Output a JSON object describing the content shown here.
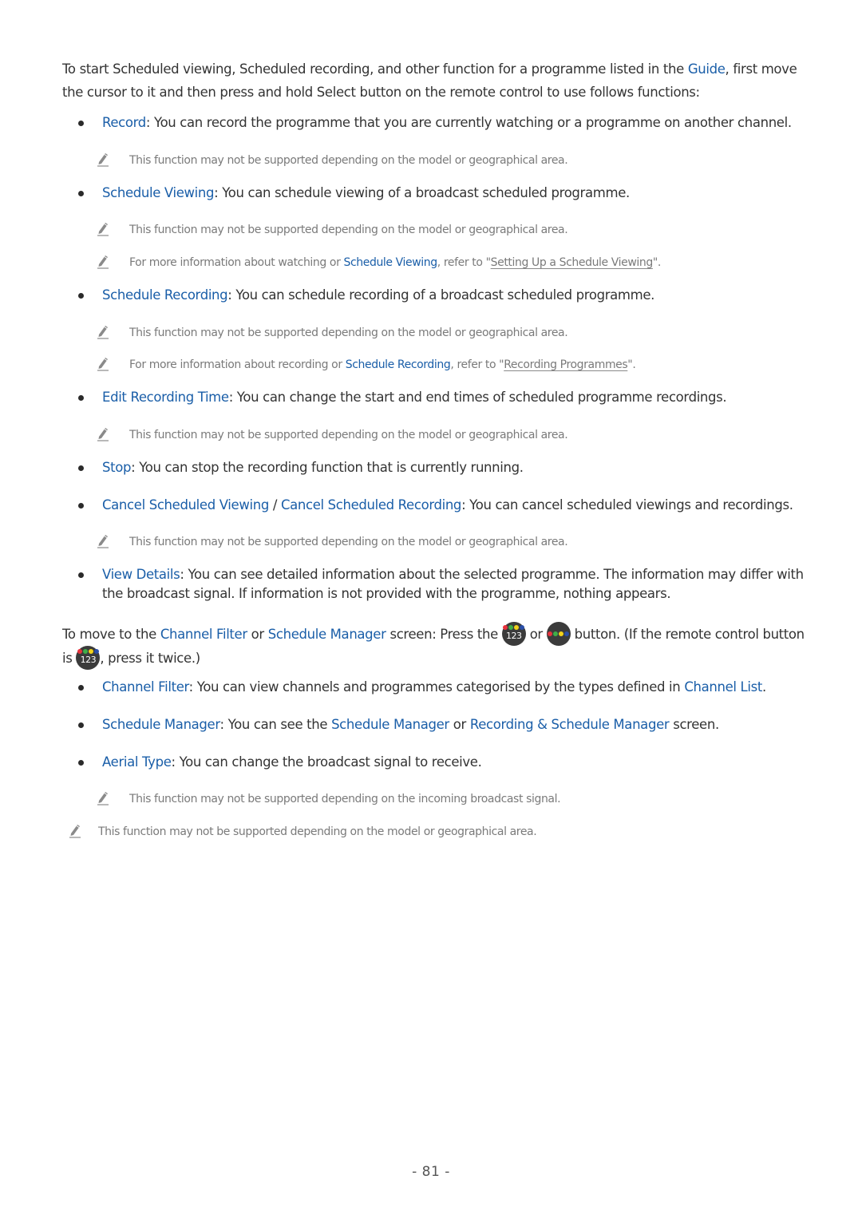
{
  "intro": {
    "text_before": "To start Scheduled viewing, Scheduled recording, and other function for a programme listed in the ",
    "link": "Guide",
    "text_after": ", first move the cursor to it and then press and hold Select button on the remote control to use follows functions:"
  },
  "functions": [
    {
      "term": "Record",
      "desc": ": You can record the programme that you are currently watching or a programme on another channel.",
      "notes": [
        {
          "text": "This function may not be supported depending on the model or geographical area."
        }
      ]
    },
    {
      "term": "Schedule Viewing",
      "desc": ": You can schedule viewing of a broadcast scheduled programme.",
      "notes": [
        {
          "text": "This function may not be supported depending on the model or geographical area."
        },
        {
          "before": "For more information about watching or ",
          "link": "Schedule Viewing",
          "middle": ", refer to \"",
          "xref": "Setting Up a Schedule Viewing",
          "after": "\"."
        }
      ]
    },
    {
      "term": "Schedule Recording",
      "desc": ": You can schedule recording of a broadcast scheduled programme.",
      "notes": [
        {
          "text": "This function may not be supported depending on the model or geographical area."
        },
        {
          "before": "For more information about recording or ",
          "link": "Schedule Recording",
          "middle": ", refer to \"",
          "xref": "Recording Programmes",
          "after": "\"."
        }
      ]
    },
    {
      "term": "Edit Recording Time",
      "desc": ": You can change the start and end times of scheduled programme recordings.",
      "notes": [
        {
          "text": "This function may not be supported depending on the model or geographical area."
        }
      ]
    },
    {
      "term": "Stop",
      "desc": ": You can stop the recording function that is currently running.",
      "notes": []
    },
    {
      "term": "Cancel Scheduled Viewing",
      "separator": " / ",
      "term2": "Cancel Scheduled Recording",
      "desc": ": You can cancel scheduled viewings and recordings.",
      "notes": [
        {
          "text": "This function may not be supported depending on the model or geographical area."
        }
      ]
    },
    {
      "term": "View Details",
      "desc": ": You can see detailed information about the selected programme. The information may differ with the broadcast signal. If information is not provided with the programme, nothing appears.",
      "notes": []
    }
  ],
  "move_para": {
    "t1": "To move to the ",
    "link1": "Channel Filter",
    "t2": " or ",
    "link2": "Schedule Manager",
    "t3": " screen: Press the ",
    "t4": " or ",
    "t5": " button. (If the remote control button is ",
    "t6": ", press it twice.)"
  },
  "remote_buttons": {
    "number_button_label": "123",
    "number_button_icon": "number-color-button-icon",
    "color_button_icon": "color-button-icon",
    "dot_colors": [
      "#e8323c",
      "#3fae49",
      "#f2d21b",
      "#2b4fa8"
    ]
  },
  "screen_functions": [
    {
      "term": "Channel Filter",
      "desc": ": You can view channels and programmes categorised by the types defined in ",
      "link": "Channel List",
      "after": "."
    },
    {
      "term": "Schedule Manager",
      "desc": ": You can see the ",
      "link": "Schedule Manager",
      "mid": " or ",
      "link2": "Recording & Schedule Manager",
      "after": " screen."
    },
    {
      "term": "Aerial Type",
      "desc": ": You can change the broadcast signal to receive.",
      "note": "This function may not be supported depending on the incoming broadcast signal."
    }
  ],
  "final_note": "This function may not be supported depending on the model or geographical area.",
  "page_number": "- 81 -",
  "colors": {
    "link": "#1a5ea8",
    "body_text": "#333333",
    "note_text": "#7a7a7a"
  }
}
